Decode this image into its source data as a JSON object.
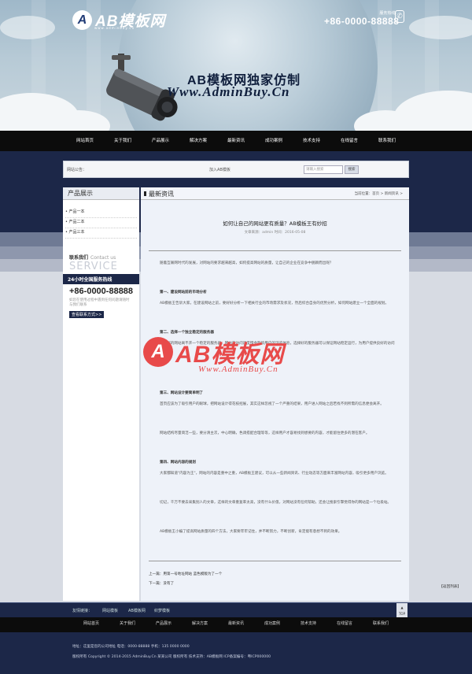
{
  "header": {
    "logo_mark": "A",
    "logo_text": "AB模板网",
    "logo_sub": "www.adminbuy.cn",
    "phone_label": "服务热线：",
    "phone_number": "+86-0000-88888",
    "slogan_cn": "AB模板网独家仿制",
    "slogan_en": "Www.AdminBuy.Cn"
  },
  "nav": [
    "网站首页",
    "关于我们",
    "产品展示",
    "解决方案",
    "最新资讯",
    "成功案例",
    "技术支持",
    "在线留言",
    "联系我们"
  ],
  "search": {
    "label": "网站公告：",
    "hot": "加入AB模板",
    "placeholder": "请输入搜索",
    "button": "搜索"
  },
  "sidebar": {
    "title": "产品展示",
    "products": [
      "产品一本",
      "产品二本",
      "产品三本"
    ],
    "contact_title": "联系我们",
    "contact_en": "Contact us",
    "contact_service": "SERVICE",
    "hotline_label": "24小时全国服务热线",
    "tel": "+86-0000-88888",
    "desc": "如您在使用过程中遇到任何问题请随时与我们联系",
    "more": "查看联系方式>>"
  },
  "main": {
    "title": "最新资讯",
    "breadcrumb": "当前位置：首页 > 新闻资讯 >",
    "article_title": "如何让自己的网站更有质量？AB模板王有妙招",
    "meta": "文章来源：admin      时间：2016-05-08",
    "paragraphs": [
      "随着互联网时代的发展，对网站的要求越来越高，如何提高网站的质量，让自己的企业在竞争中脱颖而出呢？",
      "第一、建设网站前的市场分析",
      "AB模板王告诉大家，在建设网站之前，要好好分析一下相关行业的市场需求及状况，然后综合自身的优势分析，如何网站建立一个全面的规划。",
      "第二、选择一个独立稳定的服务器",
      "一个好的网站离不开一个稳定的服务器，网站的访问速度慢会影响用户的浏览体验，选择好的服务器可以保证网站稳定运行，为用户提供良好的访问体验。",
      "第三、网站设计要简单明了",
      "首页应该为了吸引用户的眼球，把网站设计得花枝招展，其实这样忽视了一个严重的结果，用户进入网站之后若找不到所需的信息便会离开。",
      "网站结构尽量简洁一些，要分清主次，中心明确，色调搭配合理等等，这样用户才容易找到想要的内容，才能留住更多的潜在客户。",
      "第四、网站内容的规划",
      "大家都知道\"内容为王\"，网站的内容是重中之重，AB模板王建议，可以从一些新闻资讯、行业动态等方面来丰富网站内容，吸引更多用户浏览。",
      "切记，千万不要去采集别人的文章，这样的文章重复率太高，没有什么价值，对网站没有任何帮助，还会让搜索引擎觉得你的网站是一个垃圾站。",
      "AB模板王小编了提高网站质量的四个方法，大家要牢牢记住，并不断努力，不断创新，肯定能有意想不到的效果。"
    ],
    "prev": "上一篇：用第一号地址网站 蓝色模版为了一个",
    "next": "下一篇：没有了",
    "back": "【返回列表】"
  },
  "watermark": {
    "mark": "A",
    "text": "AB模板网",
    "url": "Www.AdminBuy.Cn"
  },
  "footer": {
    "links_label": "友情链接：",
    "links": [
      "网站模板",
      "AB模板网",
      "织梦模板"
    ],
    "top": "TOP",
    "nav": [
      "网站首页",
      "关于我们",
      "产品展示",
      "解决方案",
      "最新资讯",
      "成功案例",
      "技术支持",
      "在线留言",
      "联系我们"
    ],
    "address": "地址：这里是您的公司地址      电话：0000-88888      手机：135 0000 0000",
    "copyright": "版权所有  Copyright © 2014-2015 AdminBuy.Cn  某某公司  版权所有     技术支持：AB模板网     ICP备案编号：粤ICP000000"
  }
}
